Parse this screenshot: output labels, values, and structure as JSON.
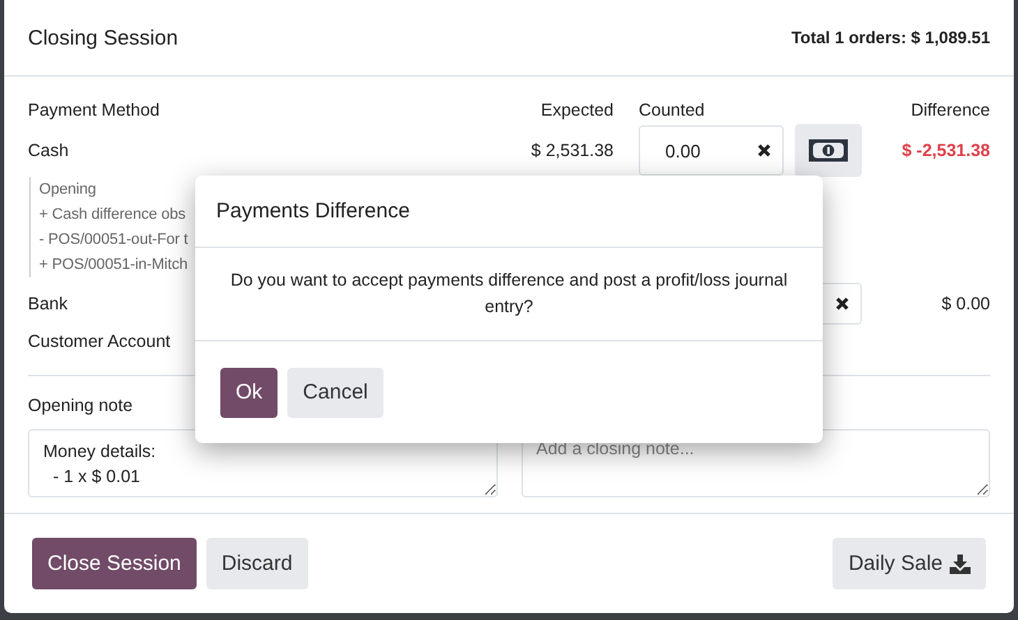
{
  "modal": {
    "title": "Closing Session",
    "total": "Total 1 orders: $ 1,089.51"
  },
  "columns": [
    "Payment Method",
    "Expected",
    "Counted",
    "Difference"
  ],
  "payments": [
    {
      "kind": "cash",
      "name": "Cash",
      "expected": "$ 2,531.38",
      "counted": "0.00",
      "difference": "$ -2,531.38",
      "negative": true,
      "details": [
        "Opening",
        "+ Cash difference obs",
        "- POS/00051-out-For t",
        "+ POS/00051-in-Mitch"
      ]
    },
    {
      "kind": "bank",
      "name": "Bank",
      "difference": "$ 0.00",
      "negative": false
    },
    {
      "kind": "plain",
      "name": "Customer Account"
    }
  ],
  "opening_note": {
    "label": "Opening note",
    "lines": [
      "Money details:",
      "  - 1 x $ 0.01"
    ]
  },
  "closing_note": {
    "placeholder": "Add a closing note..."
  },
  "footer": {
    "buttons": [
      {
        "label": "Close Session",
        "primary": true
      },
      {
        "label": "Discard",
        "primary": false
      }
    ],
    "daily_sale": "Daily Sale"
  },
  "dialog": {
    "title": "Payments Difference",
    "message": "Do you want to accept payments difference and post a profit/loss journal entry?",
    "buttons": [
      {
        "label": "Ok",
        "primary": true
      },
      {
        "label": "Cancel",
        "primary": false
      }
    ]
  }
}
